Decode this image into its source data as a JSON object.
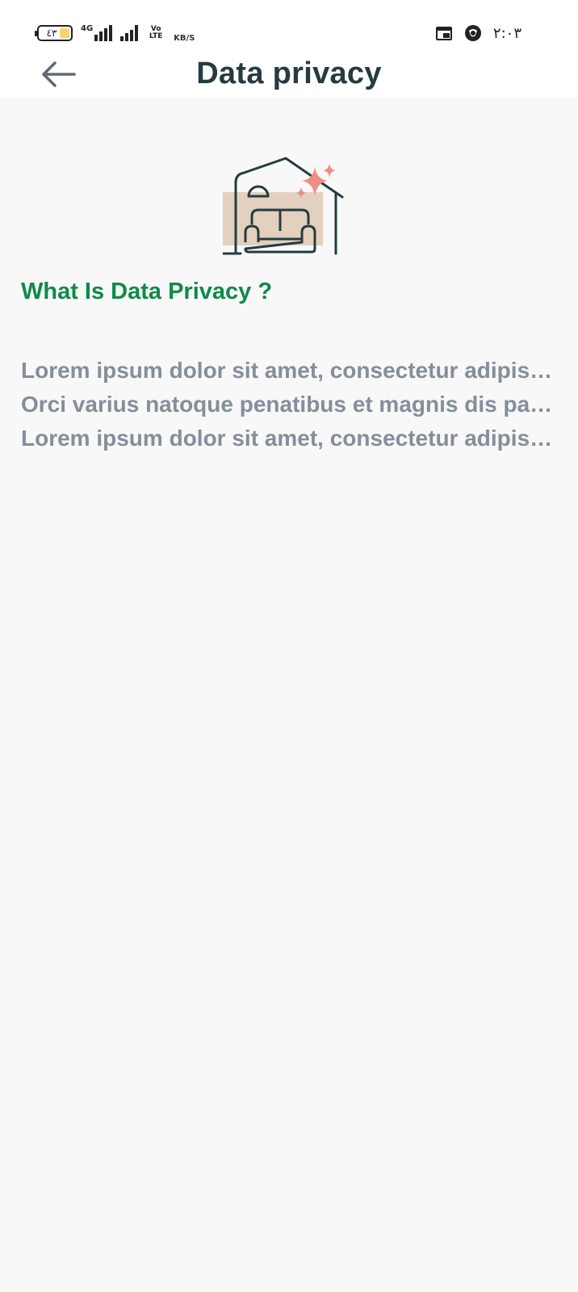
{
  "status_bar": {
    "battery_level": "٤٣",
    "network_type": "4G",
    "volte_label": "Vo LTE",
    "speed_unit": "KB/S",
    "time": "٢:٠٣",
    "icons": [
      "battery-icon",
      "signal-icon",
      "volte-icon",
      "calendar-icon",
      "vpn-icon"
    ]
  },
  "header": {
    "title": "Data privacy",
    "back_icon": "arrow-left-icon"
  },
  "content": {
    "illustration_icon": "home-sofa-illustration-icon",
    "section_title": "What Is Data Privacy ?",
    "paragraphs": [
      "Lorem ipsum dolor sit amet, consectetur adipiscing elit.",
      "Orci varius natoque penatibus et magnis dis parturient montes.",
      "Lorem ipsum dolor sit amet, consectetur adipiscing elit."
    ]
  },
  "colors": {
    "title": "#253b40",
    "section_title": "#0f8a4a",
    "body_text": "#858e9b",
    "accent_sparkle": "#ee8f84",
    "illustration_fill": "#e3d0bf",
    "background": "#f8f8f8"
  }
}
